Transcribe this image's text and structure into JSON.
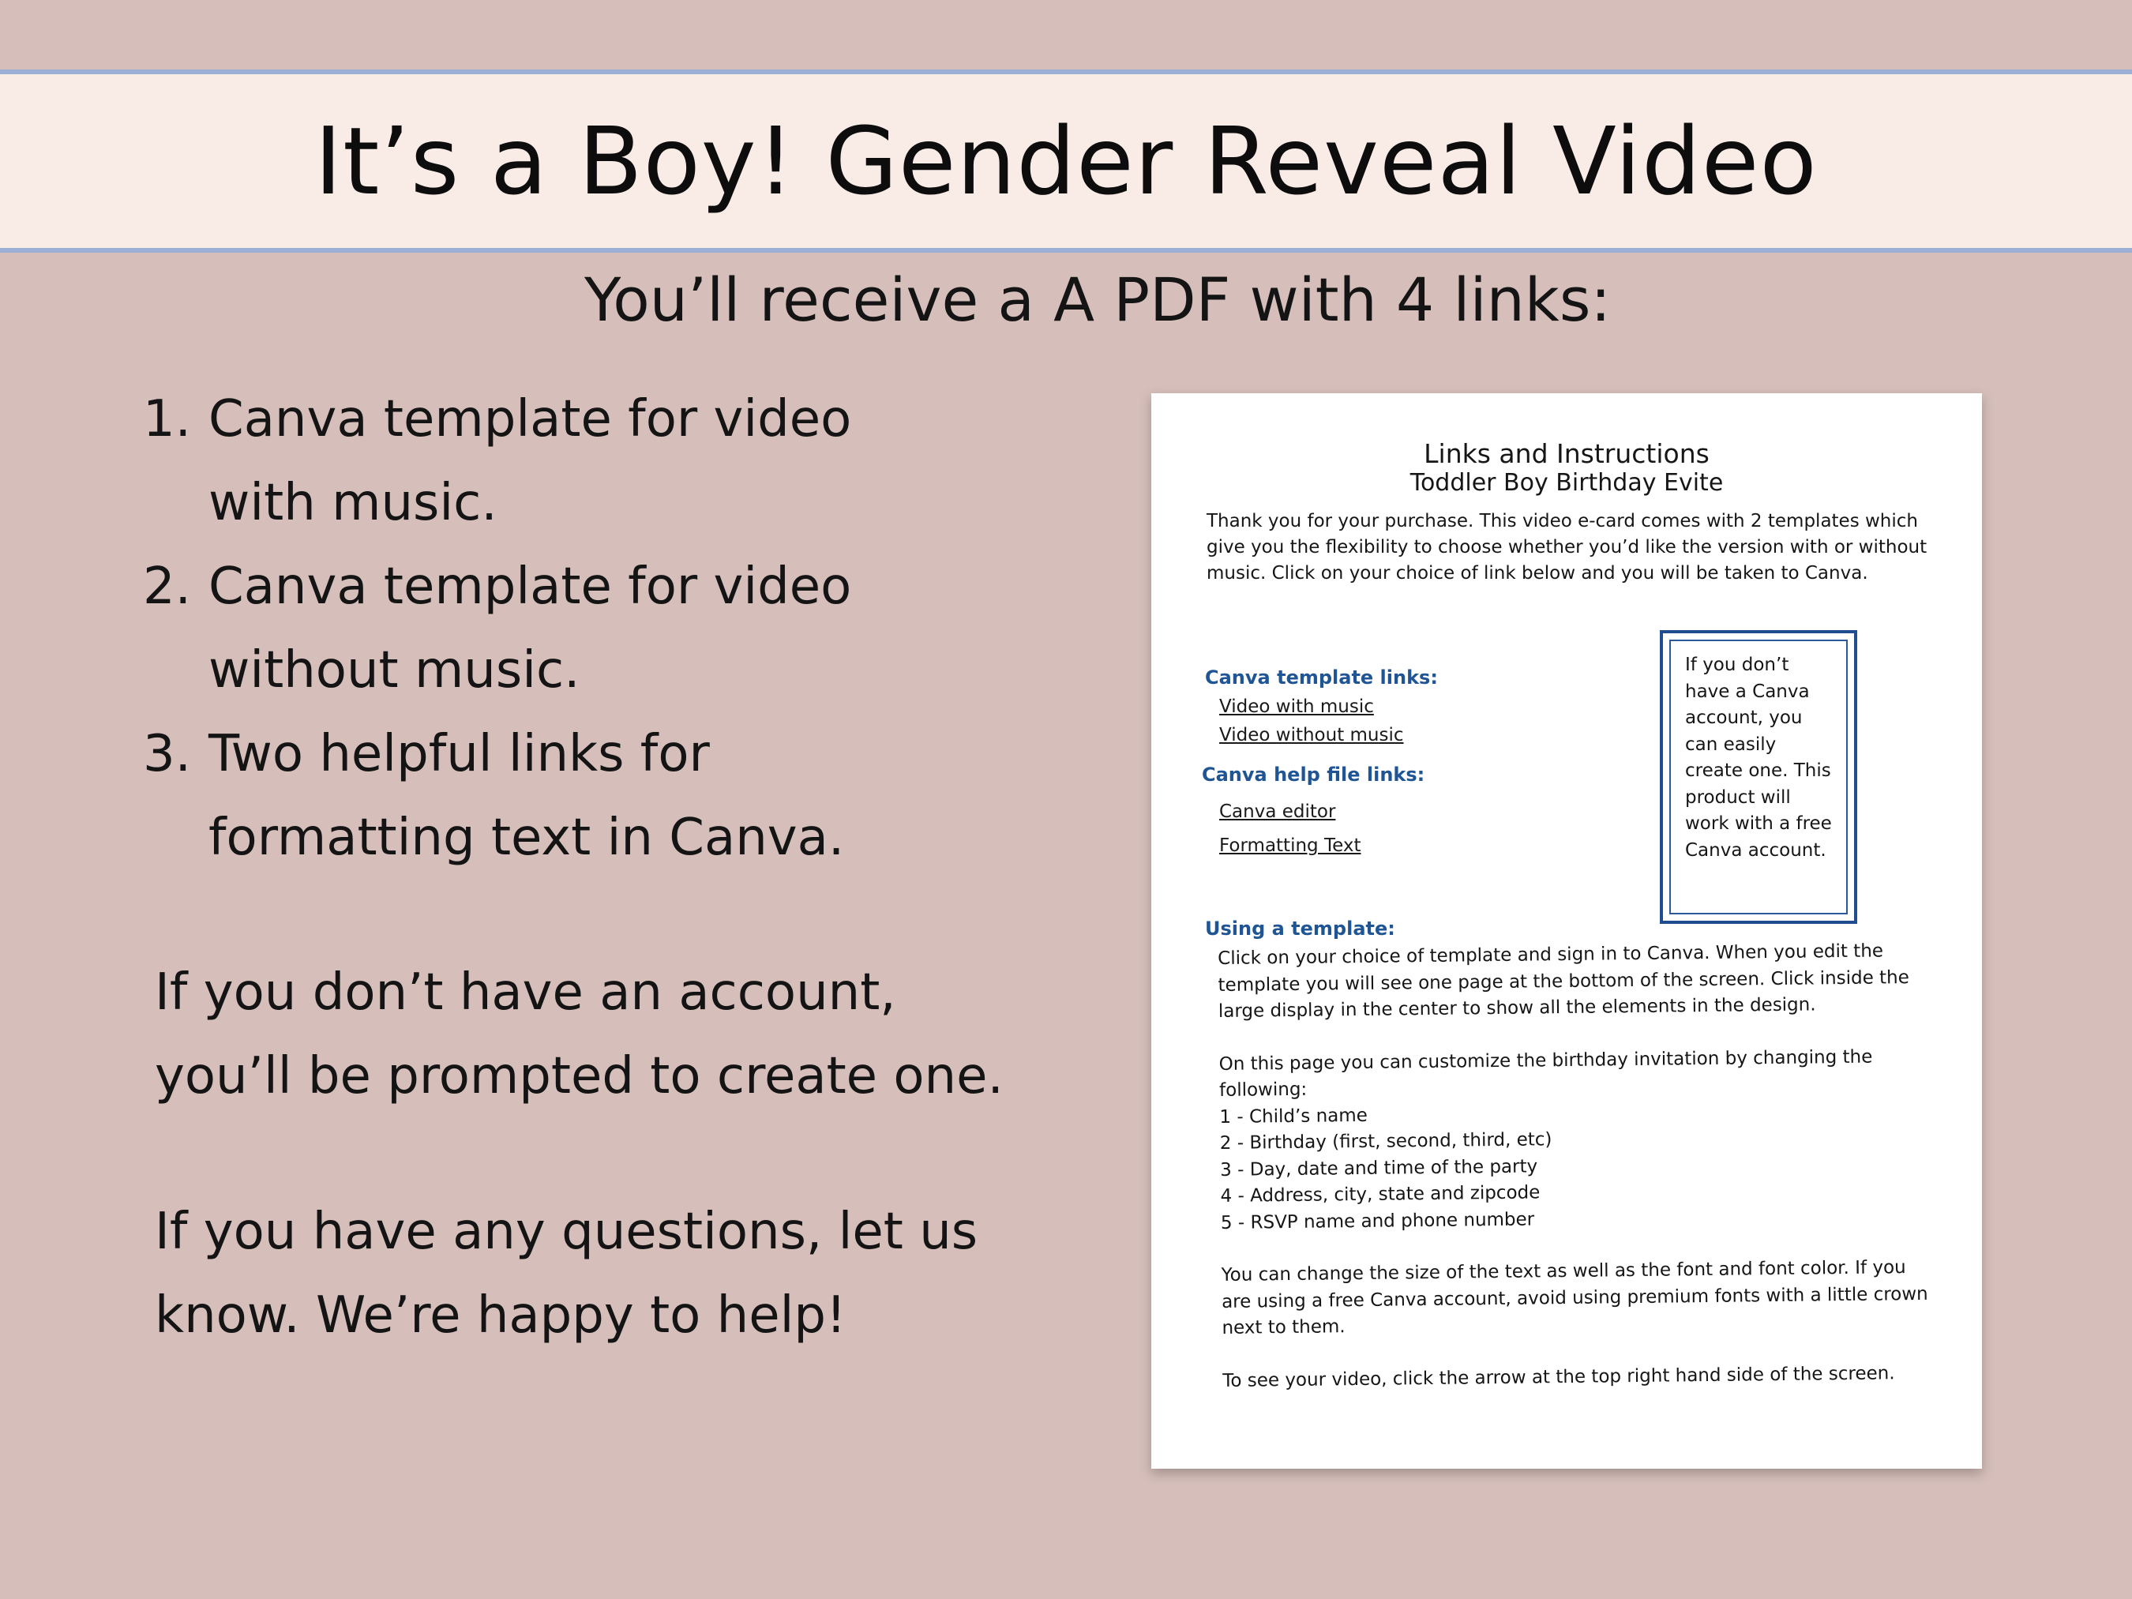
{
  "header": {
    "title": "It’s a Boy! Gender Reveal Video"
  },
  "subtitle": "You’ll receive a A PDF with 4 links:",
  "steps": [
    {
      "num": "1.",
      "text": "Canva template for video with music."
    },
    {
      "num": "2.",
      "text": "Canva template for video without music."
    },
    {
      "num": "3.",
      "text": "Two helpful links for formatting text in Canva."
    }
  ],
  "notes": {
    "account": "If you don’t have an account, you’ll be prompted to create one.",
    "questions": "If you have any questions, let us know. We’re happy to help!"
  },
  "pdf": {
    "title": "Links and Instructions",
    "subtitle": "Toddler Boy Birthday Evite",
    "intro": "Thank you for your purchase. This video e-card comes with 2 templates which give you the flexibility to choose whether you’d like the version with or without music. Click on your choice of link below and you will be taken to Canva.",
    "template_links_heading": "Canva template links:",
    "template_links": [
      "Video with music",
      "Video without music"
    ],
    "help_links_heading": "Canva help file links:",
    "help_links": [
      "Canva editor",
      "Formatting Text"
    ],
    "sidebox": "If you don’t have a Canva account, you can easily create one. This product will work with a free Canva account.",
    "using_heading": "Using a template:",
    "using_p1": "Click on your choice of template and sign in to Canva. When you edit the template you will see one page at the bottom of the screen. Click inside the large display in the center to show all the elements in the design.",
    "using_p2": "On this page  you can customize the birthday invitation by changing the following:",
    "using_list": [
      "1 - Child’s name",
      "2 - Birthday (first, second, third, etc)",
      "3 - Day, date and time of the party",
      "4 - Address, city, state and zipcode",
      "5 - RSVP name and phone number"
    ],
    "using_p3": "You can change the size of the text as well as the font and font color. If you are using a free Canva account, avoid using premium fonts with a little crown next to them.",
    "using_p4": "To see your video, click the arrow at the top right hand side of the screen."
  },
  "colors": {
    "background": "#d6bfba",
    "banner": "#f9ece7",
    "banner_border": "#9cb0d5",
    "link_heading": "#1f5594",
    "box_border": "#1f4d8f"
  }
}
